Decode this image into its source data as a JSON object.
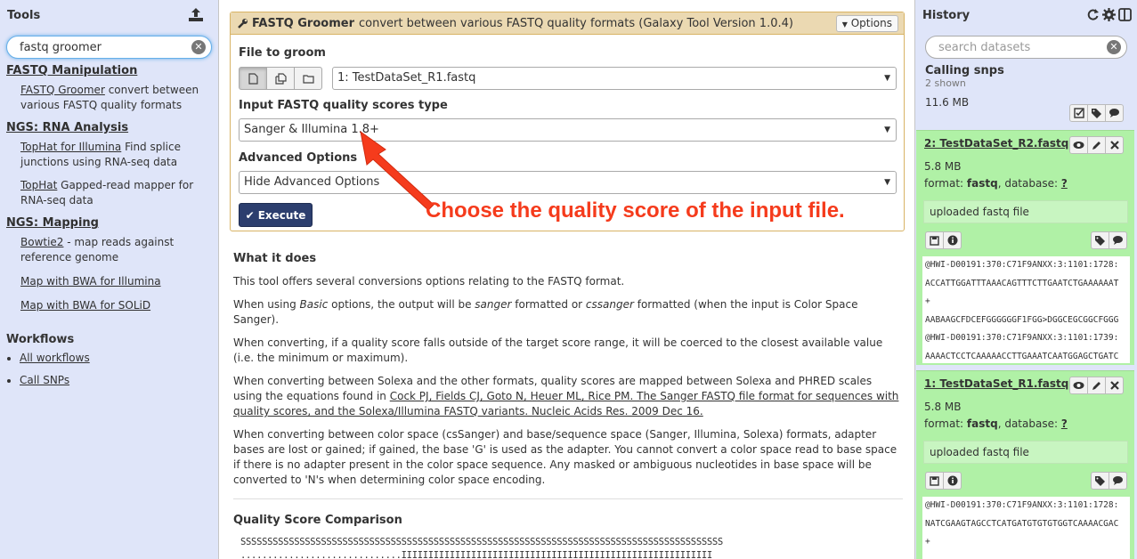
{
  "tools_panel": {
    "title": "Tools",
    "search_value": "fastq groomer",
    "sections": [
      {
        "title": "FASTQ Manipulation",
        "tools": [
          {
            "name": "FASTQ Groomer",
            "desc": " convert between various FASTQ quality formats"
          }
        ]
      },
      {
        "title": "NGS: RNA Analysis",
        "tools": [
          {
            "name": "TopHat for Illumina",
            "desc": " Find splice junctions using RNA-seq data"
          },
          {
            "name": "TopHat",
            "desc": " Gapped-read mapper for RNA-seq data"
          }
        ]
      },
      {
        "title": "NGS: Mapping",
        "tools": [
          {
            "name": "Bowtie2",
            "desc": " - map reads against reference genome"
          },
          {
            "name": "Map with BWA for Illumina",
            "desc": ""
          },
          {
            "name": "Map with BWA for SOLiD",
            "desc": ""
          }
        ]
      }
    ],
    "workflows_title": "Workflows",
    "workflows": [
      "All workflows",
      "Call SNPs"
    ]
  },
  "tool_form": {
    "tool_name": "FASTQ Groomer",
    "tool_desc": "convert between various FASTQ quality formats (Galaxy Tool Version 1.0.4)",
    "options_label": "Options",
    "file_label": "File to groom",
    "file_value": "1: TestDataSet_R1.fastq",
    "quality_label": "Input FASTQ quality scores type",
    "quality_value": "Sanger & Illumina 1.8+",
    "advanced_label": "Advanced Options",
    "advanced_value": "Hide Advanced Options",
    "execute_label": "Execute"
  },
  "annotation": "Choose the quality score of the input file.",
  "help": {
    "heading": "What it does",
    "p1": "This tool offers several conversions options relating to the FASTQ format.",
    "p2_a": "When using ",
    "p2_basic": "Basic",
    "p2_b": " options, the output will be ",
    "p2_sanger": "sanger",
    "p2_c": " formatted or ",
    "p2_cssanger": "cssanger",
    "p2_d": " formatted (when the input is Color Space Sanger).",
    "p3": "When converting, if a quality score falls outside of the target score range, it will be coerced to the closest available value (i.e. the minimum or maximum).",
    "p4_a": "When converting between Solexa and the other formats, quality scores are mapped between Solexa and PHRED scales using the equations found in ",
    "p4_link": "Cock PJ, Fields CJ, Goto N, Heuer ML, Rice PM. The Sanger FASTQ file format for sequences with quality scores, and the Solexa/Illumina FASTQ variants. Nucleic Acids Res. 2009 Dec 16.",
    "p5": "When converting between color space (csSanger) and base/sequence space (Sanger, Illumina, Solexa) formats, adapter bases are lost or gained; if gained, the base 'G' is used as the adapter. You cannot convert a color space read to base space if there is no adapter present in the color space sequence. Any masked or ambiguous nucleotides in base space will be converted to 'N's when determining color space encoding.",
    "quality_heading": "Quality Score Comparison",
    "mono1": "SSSSSSSSSSSSSSSSSSSSSSSSSSSSSSSSSSSSSSSSSSSSSSSSSSSSSSSSSSSSSSSSSSSSSSSSSSSSSSSSSSSSSSSSSS",
    "mono2": "..............................IIIIIIIIIIIIIIIIIIIIIIIIIIIIIIIIIIIIIIIIIIIIIIIIIIIIIIIIII"
  },
  "history": {
    "title": "History",
    "search_placeholder": "search datasets",
    "name": "Calling snps",
    "shown": "2 shown",
    "size": "11.6 MB",
    "datasets": [
      {
        "title": "2: TestDataSet_R2.fastq",
        "size": "5.8 MB",
        "format_label": "format: ",
        "format": "fastq",
        "db_label": ", database: ",
        "db": "?",
        "info": "uploaded fastq file",
        "peek": [
          "@HWI-D00191:370:C71F9ANXX:3:1101:1728:",
          "ACCATTGGATTTAAACAGTTTCTTGAATCTGAAAAAAT",
          "+",
          "AABAAGCFDCEFGGGGGGF1FGG>DGGCEGCGGCFGGG",
          "@HWI-D00191:370:C71F9ANXX:3:1101:1739:",
          "AAAACTCCTCAAAAACCTTGAAATCAATGGAGCTGATC"
        ]
      },
      {
        "title": "1: TestDataSet_R1.fastq",
        "size": "5.8 MB",
        "format_label": "format: ",
        "format": "fastq",
        "db_label": ", database: ",
        "db": "?",
        "info": "uploaded fastq file",
        "peek": [
          "@HWI-D00191:370:C71F9ANXX:3:1101:1728:",
          "NATCGAAGTAGCCTCATGATGTGTGTGGTCAAAACGAC",
          "+"
        ]
      }
    ]
  }
}
